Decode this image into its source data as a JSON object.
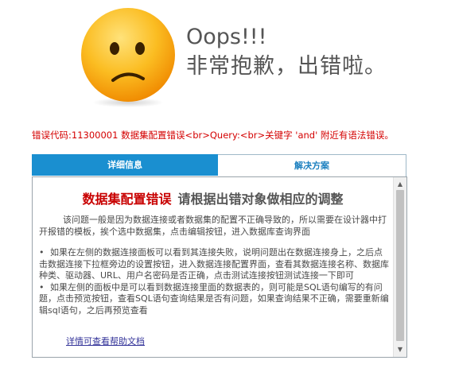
{
  "header": {
    "oops": "Oops!!!",
    "apology": "非常抱歉，出错啦。"
  },
  "error_line": "错误代码:11300001 数据集配置错误<br>Query:<br>关键字 'and' 附近有语法错误。",
  "tabs": [
    {
      "label": "详细信息",
      "active": true
    },
    {
      "label": "解决方案",
      "active": false
    }
  ],
  "panel": {
    "title_red": "数据集配置错误",
    "title_gray": "请根据出错对象做相应的调整",
    "paragraph": "该问题一般是因为数据连接或者数据集的配置不正确导致的，所以需要在设计器中打开报错的模板，挨个选中数据集，点击编辑按钮，进入数据库查询界面",
    "bullets": [
      "如果在左侧的数据连接面板可以看到其连接失败，说明问题出在数据连接身上，之后点击数据连接下拉框旁边的设置按钮，进入数据连接配置界面，查看其数据连接名称、数据库种类、驱动器、URL、用户名密码是否正确，点击测试连接按钮测试连接一下即可",
      "如果左侧的面板中是可以看到数据连接里面的数据表的，则可能是SQL语句编写的有问题，点击预览按钮，查看SQL语句查询结果是否有问题，如果查询结果不正确，需要重新编辑sql语句，之后再预览查看"
    ],
    "bullet_symbol": "•",
    "help_link": "详情可查看帮助文档"
  },
  "icons": {
    "face": "sad-face-icon",
    "scroll_up": "▲",
    "scroll_down": "▼"
  },
  "colors": {
    "error_red": "#d40000",
    "tab_active": "#1a8fd0",
    "title_red": "#c80000",
    "face": "#f5a400"
  }
}
